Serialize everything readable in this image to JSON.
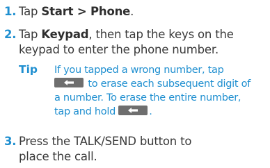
{
  "steps": [
    {
      "number": "1.",
      "line1_prefix": "Tap ",
      "line1_bold": "Start > Phone",
      "line1_suffix": "."
    },
    {
      "number": "2.",
      "line1_prefix": "Tap ",
      "line1_bold": "Keypad",
      "line1_suffix": ", then tap the keys on the",
      "line2": "keypad to enter the phone number."
    },
    {
      "number": "3.",
      "line1": "Press the TALK/SEND button to",
      "line2": "place the call."
    }
  ],
  "tip": {
    "label": "Tip",
    "line1": "If you tapped a wrong number, tap",
    "line2_suffix": "to erase each subsequent digit of",
    "line3": "a number. To erase the entire number,",
    "line4_prefix": "tap and hold",
    "line4_suffix": "."
  },
  "icons": {
    "backspace_key": "backspace-key-icon"
  },
  "colors": {
    "accent": "#1f8fd0",
    "text": "#3a3a3a",
    "key_bg": "#6e6e6e"
  }
}
